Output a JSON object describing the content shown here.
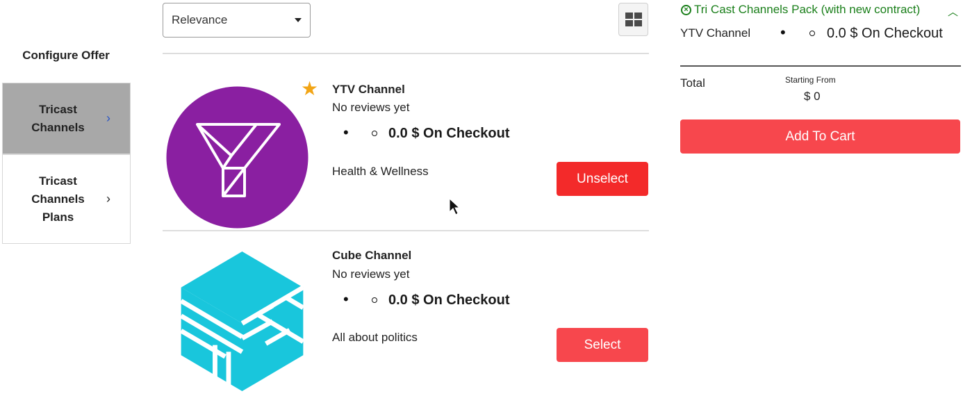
{
  "sidebar": {
    "title": "Configure Offer",
    "items": [
      {
        "label_lines": [
          "Tricast",
          "Channels"
        ],
        "active": true
      },
      {
        "label_lines": [
          "Tricast",
          "Channels",
          "Plans"
        ],
        "active": false
      }
    ]
  },
  "toolbar": {
    "sort_value": "Relevance"
  },
  "channels": [
    {
      "name": "YTV Channel",
      "reviews": "No reviews yet",
      "price": "0.0 $ On Checkout",
      "description": "Health & Wellness",
      "button_label": "Unselect",
      "featured": true
    },
    {
      "name": "Cube Channel",
      "reviews": "No reviews yet",
      "price": "0.0 $ On Checkout",
      "description": "All about politics",
      "button_label": "Select",
      "featured": false
    }
  ],
  "summary": {
    "pack_title": "Tri Cast Channels Pack (with new contract)",
    "line_item_name": "YTV Channel",
    "line_item_price": "0.0 $ On Checkout",
    "total_label": "Total",
    "starting_from_label": "Starting From",
    "total_value": "$ 0",
    "add_to_cart_label": "Add To Cart"
  },
  "colors": {
    "accent_red": "#f7474d",
    "unselect_red": "#f32a2a",
    "pack_green": "#1a7f1a",
    "ytv_purple": "#8a1fa1",
    "cube_cyan": "#19c6dc"
  }
}
